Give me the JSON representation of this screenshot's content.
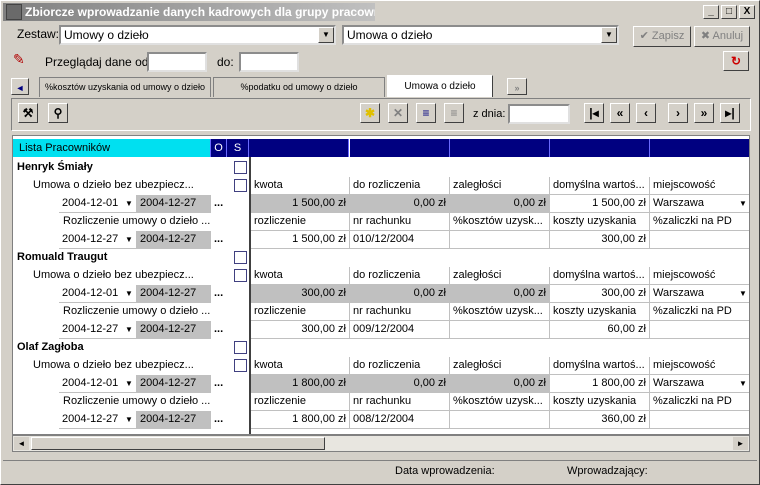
{
  "window": {
    "title": "Zbiorcze wprowadzanie danych kadrowych dla grupy pracowników",
    "controls": [
      "_",
      "□",
      "X"
    ]
  },
  "filters": {
    "zestaw_label": "Zestaw:",
    "zestaw_value": "Umowy o dzieło",
    "second_value": "Umowa o dzieło",
    "przegladaj_label": "Przeglądaj dane od:",
    "do_label": "do:",
    "zapisz": "✔ Zapisz",
    "anuluj": "✖ Anuluj"
  },
  "tabs": {
    "nav_left": "◄",
    "t1": "%kosztów uzyskania od umowy o dzieło",
    "t2": "%podatku od umowy o dzieło",
    "t3": "Umowa o dzieło",
    "nav_right": "»"
  },
  "toolbar": {
    "z_dnia": "z dnia:"
  },
  "grid": {
    "header_list": "Lista Pracowników",
    "header_o": "O",
    "header_s": "S",
    "rows": [
      {
        "name": "Henryk Śmiały",
        "contract": "Umowa o dzieło bez ubezpiecz...",
        "d1": "2004-12-01",
        "d2": "2004-12-27",
        "settle": "Rozliczenie umowy o dzieło ...",
        "d3": "2004-12-27",
        "d4": "2004-12-27",
        "h1": "kwota",
        "h2": "do rozliczenia",
        "h3": "zaległości",
        "h4": "domyślna wartoś...",
        "h5": "miejscowość",
        "v1": "1 500,00 zł",
        "v2": "0,00 zł",
        "v3": "0,00 zł",
        "v4": "1 500,00 zł",
        "v5": "Warszawa",
        "s1": "rozliczenie",
        "s2": "nr rachunku",
        "s3": "%kosztów uzysk...",
        "s4": "koszty uzyskania",
        "s5": "%zaliczki na PD",
        "w1": "1 500,00 zł",
        "w2": "010/12/2004",
        "w4": "300,00 zł"
      },
      {
        "name": "Romuald Traugut",
        "contract": "Umowa o dzieło bez ubezpiecz...",
        "d1": "2004-12-01",
        "d2": "2004-12-27",
        "settle": "Rozliczenie umowy o dzieło ...",
        "d3": "2004-12-27",
        "d4": "2004-12-27",
        "h1": "kwota",
        "h2": "do rozliczenia",
        "h3": "zaległości",
        "h4": "domyślna wartoś...",
        "h5": "miejscowość",
        "v1": "300,00 zł",
        "v2": "0,00 zł",
        "v3": "0,00 zł",
        "v4": "300,00 zł",
        "v5": "Warszawa",
        "s1": "rozliczenie",
        "s2": "nr rachunku",
        "s3": "%kosztów uzysk...",
        "s4": "koszty uzyskania",
        "s5": "%zaliczki na PD",
        "w1": "300,00 zł",
        "w2": "009/12/2004",
        "w4": "60,00 zł"
      },
      {
        "name": "Olaf Zagłoba",
        "contract": "Umowa o dzieło bez ubezpiecz...",
        "d1": "2004-12-01",
        "d2": "2004-12-27",
        "settle": "Rozliczenie umowy o dzieło ...",
        "d3": "2004-12-27",
        "d4": "2004-12-27",
        "h1": "kwota",
        "h2": "do rozliczenia",
        "h3": "zaległości",
        "h4": "domyślna wartoś...",
        "h5": "miejscowość",
        "v1": "1 800,00 zł",
        "v2": "0,00 zł",
        "v3": "0,00 zł",
        "v4": "1 800,00 zł",
        "v5": "Warszawa",
        "s1": "rozliczenie",
        "s2": "nr rachunku",
        "s3": "%kosztów uzysk...",
        "s4": "koszty uzyskania",
        "s5": "%zaliczki na PD",
        "w1": "1 800,00 zł",
        "w2": "008/12/2004",
        "w4": "360,00 zł"
      }
    ]
  },
  "status": {
    "data_wprowadzenia": "Data wprowadzenia:",
    "wprowadzajacy": "Wprowadzający:"
  }
}
